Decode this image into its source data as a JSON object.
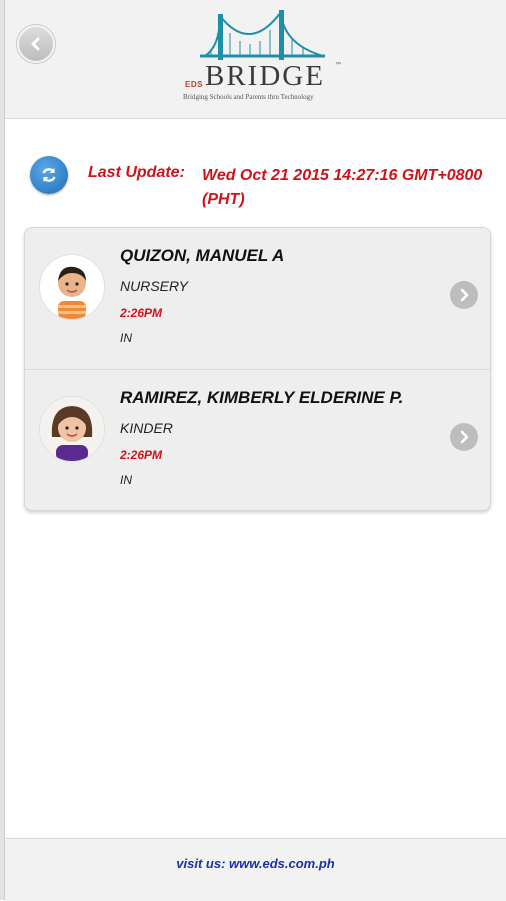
{
  "header": {
    "brand_prefix": "EDS",
    "brand_name": "BRIDGE",
    "brand_tm": "™",
    "tagline": "Bridging Schools and Parents thru Technology",
    "back_icon": "chevron-left-icon"
  },
  "update": {
    "label": "Last Update:",
    "value": "Wed Oct 21 2015 14:27:16 GMT+0800 (PHT)",
    "refresh_icon": "refresh-icon"
  },
  "students": [
    {
      "name": "QUIZON, MANUEL A",
      "grade": "NURSERY",
      "time": "2:26PM",
      "status": "IN"
    },
    {
      "name": "RAMIREZ, KIMBERLY ELDERINE P.",
      "grade": "KINDER",
      "time": "2:26PM",
      "status": "IN"
    }
  ],
  "footer": {
    "text": "visit us: www.eds.com.ph"
  },
  "colors": {
    "accent_red": "#d0121a",
    "link_blue": "#1b2fa8",
    "refresh_blue": "#1f6fb8",
    "logo_teal": "#1f8fa8"
  }
}
